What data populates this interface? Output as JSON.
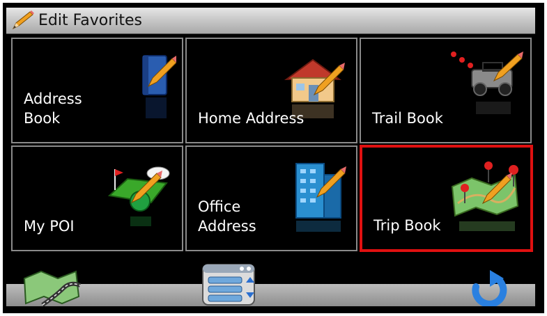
{
  "header": {
    "title": "Edit Favorites",
    "icon": "pencil-icon"
  },
  "tiles": [
    {
      "id": "address-book",
      "label": "Address\nBook",
      "icon": "address-book-icon"
    },
    {
      "id": "home-address",
      "label": "Home Address",
      "icon": "house-icon"
    },
    {
      "id": "trail-book",
      "label": "Trail Book",
      "icon": "jeep-icon"
    },
    {
      "id": "my-poi",
      "label": "My POI",
      "icon": "poi-icon"
    },
    {
      "id": "office-address",
      "label": "Office\nAddress",
      "icon": "office-building-icon"
    },
    {
      "id": "trip-book",
      "label": "Trip Book",
      "icon": "trip-map-icon",
      "selected": true
    }
  ],
  "toolbar": {
    "map_icon": "map-icon",
    "menu_icon": "menu-list-icon",
    "back_icon": "back-arrow-icon"
  },
  "colors": {
    "selection": "#e01010",
    "tile_border": "#8a8a8a",
    "background": "#000000"
  }
}
